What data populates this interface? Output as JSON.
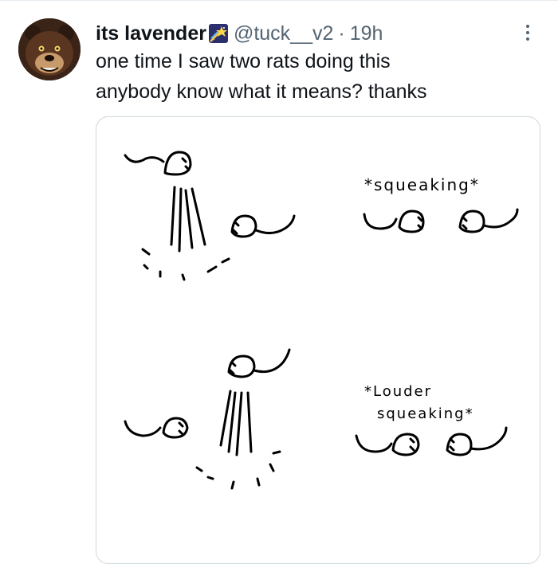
{
  "tweet": {
    "author_name": "its lavender",
    "author_badge_icon": "shooting-star-icon",
    "handle": "@tuck__v2",
    "separator": "·",
    "time": "19h",
    "text_lines": [
      "one time I saw two rats doing this",
      "anybody know what it means? thanks"
    ]
  },
  "image": {
    "panel_captions": [
      "*squeaking*",
      "*Louder",
      "squeaking*"
    ]
  },
  "icons": {
    "avatar": "bear-avatar",
    "more": "more-options-icon"
  }
}
